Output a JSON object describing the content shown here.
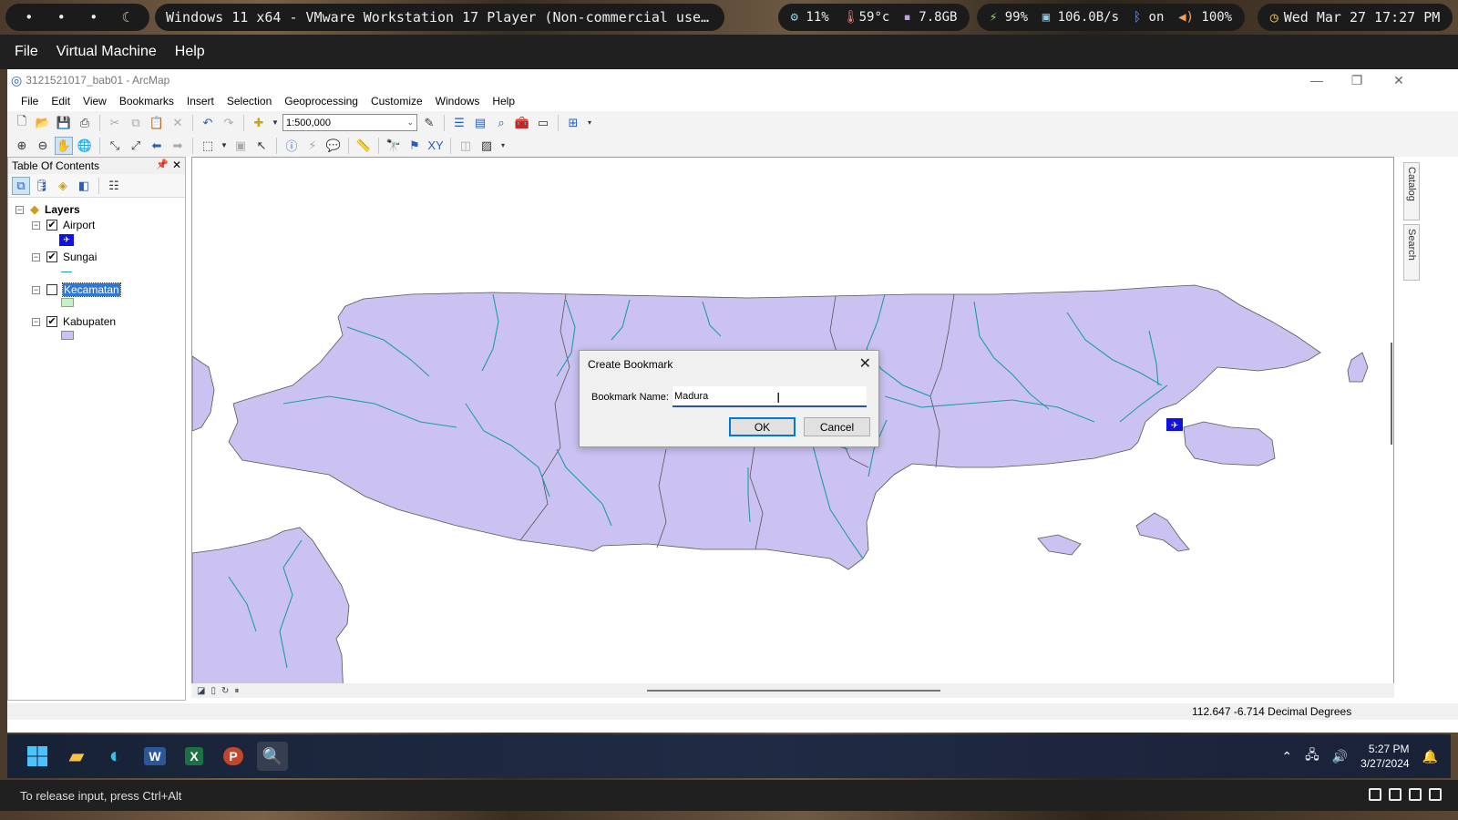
{
  "topbar": {
    "workspaces": [
      "•",
      "•",
      "•",
      "☾"
    ],
    "window_title": "Windows 11 x64 - VMware Workstation 17 Player (Non-commercial use…",
    "cpu": "11%",
    "temp": "59°c",
    "mem": "7.8GB",
    "battery": "99%",
    "net": "106.0B/s",
    "bluetooth": "on",
    "volume": "100%",
    "datetime": "Wed Mar 27 17:27 PM"
  },
  "vm_menu": [
    "File",
    "Virtual Machine",
    "Help"
  ],
  "arcmap": {
    "title": "3121521017_bab01 - ArcMap",
    "menu": [
      "File",
      "Edit",
      "View",
      "Bookmarks",
      "Insert",
      "Selection",
      "Geoprocessing",
      "Customize",
      "Windows",
      "Help"
    ],
    "scale": "1:500,000"
  },
  "toc": {
    "title": "Table Of Contents",
    "root": "Layers",
    "layers": [
      {
        "name": "Airport",
        "checked": true
      },
      {
        "name": "Sungai",
        "checked": true
      },
      {
        "name": "Kecamatan",
        "checked": false
      },
      {
        "name": "Kabupaten",
        "checked": true
      }
    ]
  },
  "dock_tabs": [
    "Catalog",
    "Search"
  ],
  "statusbar": {
    "coords": "112.647  -6.714 Decimal Degrees"
  },
  "dialog": {
    "title": "Create Bookmark",
    "label": "Bookmark Name:",
    "value": "Madura",
    "ok": "OK",
    "cancel": "Cancel"
  },
  "taskbar": {
    "time": "5:27 PM",
    "date": "3/27/2024"
  },
  "vm_bottom": {
    "hint": "To release input, press Ctrl+Alt"
  },
  "colors": {
    "land": "#cbc2f2",
    "river": "#1e9aa8",
    "airport": "#1010e0",
    "kecamatan": "#c8f0c8",
    "selection": "#3078d8"
  }
}
